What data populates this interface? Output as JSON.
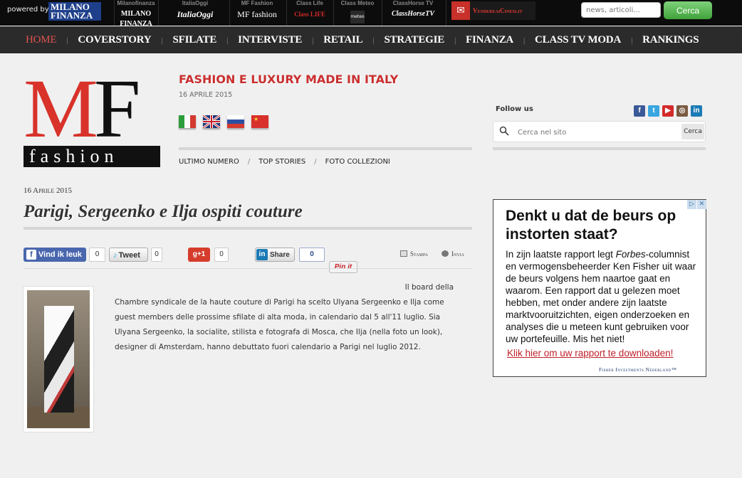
{
  "topbar": {
    "powered_by": "powered by",
    "logo_line1": "MILANO",
    "logo_line2": "FINANZA",
    "networks": [
      {
        "caption": "Milanofinanza",
        "mark": "MILANO FINANZA"
      },
      {
        "caption": "ItaliaOggi",
        "mark": "ItaliaOggi"
      },
      {
        "caption": "MF Fashion",
        "mark": "MF fashion"
      },
      {
        "caption": "Class Life",
        "mark": "Class LIFE"
      },
      {
        "caption": "Class Meteo",
        "mark": "meteo"
      },
      {
        "caption": "ClassHorse TV",
        "mark": "ClassHorseTV"
      }
    ],
    "vendere_label": "VendereaiCinesi.it",
    "search_placeholder": "news, articoli...",
    "search_button": "Cerca"
  },
  "mainnav": {
    "items": [
      "HOME",
      "COVERSTORY",
      "SFILATE",
      "INTERVISTE",
      "RETAIL",
      "STRATEGIE",
      "FINANZA",
      "CLASS TV MODA",
      "RANKINGS"
    ],
    "active": "HOME"
  },
  "header": {
    "logo_letters_m": "M",
    "logo_letters_f": "F",
    "logo_band": "fashion",
    "tagline": "FASHION E LUXURY MADE IN ITALY",
    "date": "16 APRILE 2015",
    "subnav": [
      "ULTIMO NUMERO",
      "TOP STORIES",
      "FOTO COLLEZIONI"
    ]
  },
  "sidebar": {
    "follow_us": "Follow us",
    "social": [
      "f",
      "t",
      "▶",
      "◎",
      "in"
    ],
    "search_placeholder": "Cerca nel sito",
    "search_button": "Cerca"
  },
  "article": {
    "date": "16 Aprile 2015",
    "title": "Parigi, Sergeenko e Ilja ospiti couture",
    "share": {
      "fb_label": "Vind ik leuk",
      "fb_count": "0",
      "tweet_label": "Tweet",
      "tweet_count": "0",
      "gplus_label": "g+1",
      "gplus_count": "0",
      "li_label": "Share",
      "li_count": "0",
      "pin_label": "Pin it",
      "print_label": "Stampa",
      "send_label": "Invia"
    },
    "lead": "Il board della",
    "body": "Chambre syndicale de la haute couture di Parigi ha scelto Ulyana Sergeenko e Ilja come guest members delle prossime sfilate di alta moda, in calendario dal 5 all'11 luglio. Sia Ulyana Sergeenko, la socialite, stilista e fotografa di Mosca, che Ilja (nella foto un look), designer di Amsterdam, hanno debuttato fuori calendario a Parigi nel luglio 2012."
  },
  "ad": {
    "headline": "Denkt u dat de beurs op instorten staat?",
    "text_part1": "In zijn laatste rapport legt ",
    "text_italic": "Forbes",
    "text_part2": "-columnist en vermogensbeheerder Ken Fisher uit waar de beurs volgens hem naartoe gaat en waarom. Een rapport dat u gelezen moet hebben, met onder andere zijn laatste marktvooruitzichten, eigen onderzoeken en analyses die u meteen kunt gebruiken voor uw portefeuille. Mis het niet!",
    "link": "Klik hier om uw rapport te downloaden!",
    "brand": "Fisher Investments Nederland™",
    "close": "✕",
    "info": "▷"
  },
  "colors": {
    "accent_red": "#c92f2f",
    "nav_bg": "#2b2b2b",
    "top_bg": "#0c0c0c",
    "search_green": "#4caf45"
  }
}
